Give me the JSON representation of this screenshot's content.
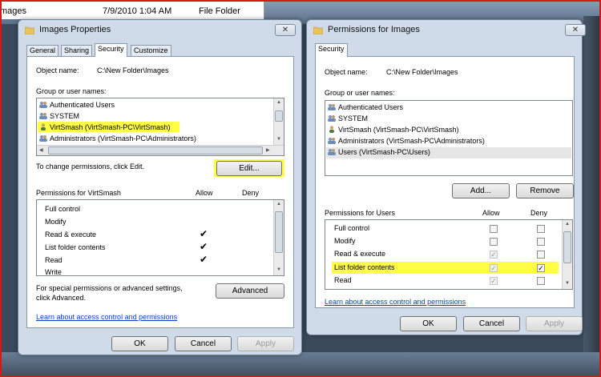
{
  "background": {
    "file_row": {
      "name": "mages",
      "date": "7/9/2010 1:04 AM",
      "type": "File Folder"
    }
  },
  "props": {
    "title": "Images Properties",
    "close_glyph": "✕",
    "tabs": [
      "General",
      "Sharing",
      "Security",
      "Customize"
    ],
    "object_label": "Object name:",
    "object_value": "C:\\New Folder\\Images",
    "group_label": "Group or user names:",
    "users": [
      "Authenticated Users",
      "SYSTEM",
      "VirtSmash (VirtSmash-PC\\VirtSmash)",
      "Administrators (VirtSmash-PC\\Administrators)"
    ],
    "change_text": "To change permissions, click Edit.",
    "edit_label": "Edit...",
    "perm_header": "Permissions for VirtSmash",
    "allow_header": "Allow",
    "deny_header": "Deny",
    "permissions": [
      {
        "name": "Full control",
        "allow": false
      },
      {
        "name": "Modify",
        "allow": false
      },
      {
        "name": "Read & execute",
        "allow": true
      },
      {
        "name": "List folder contents",
        "allow": true
      },
      {
        "name": "Read",
        "allow": true
      },
      {
        "name": "Write",
        "allow": false
      }
    ],
    "tick_glyph": "✔",
    "special_text_1": "For special permissions or advanced settings,",
    "special_text_2": "click Advanced.",
    "advanced_label": "Advanced",
    "learn_link": "Learn about access control and permissions",
    "ok_label": "OK",
    "cancel_label": "Cancel",
    "apply_label": "Apply"
  },
  "perms": {
    "title": "Permissions for Images",
    "close_glyph": "✕",
    "tab": "Security",
    "object_label": "Object name:",
    "object_value": "C:\\New Folder\\Images",
    "group_label": "Group or user names:",
    "users": [
      "Authenticated Users",
      "SYSTEM",
      "VirtSmash (VirtSmash-PC\\VirtSmash)",
      "Administrators (VirtSmash-PC\\Administrators)",
      "Users (VirtSmash-PC\\Users)"
    ],
    "add_label": "Add...",
    "remove_label": "Remove",
    "perm_header": "Permissions for Users",
    "allow_header": "Allow",
    "deny_header": "Deny",
    "permissions": [
      {
        "name": "Full control",
        "allow": false,
        "allow_disabled": false,
        "deny": false
      },
      {
        "name": "Modify",
        "allow": false,
        "allow_disabled": false,
        "deny": false
      },
      {
        "name": "Read & execute",
        "allow": true,
        "allow_disabled": true,
        "deny": false
      },
      {
        "name": "List folder contents",
        "allow": true,
        "allow_disabled": true,
        "deny": true
      },
      {
        "name": "Read",
        "allow": true,
        "allow_disabled": true,
        "deny": false
      }
    ],
    "check_glyph": "✓",
    "learn_link": "Learn about access control and permissions",
    "ok_label": "OK",
    "cancel_label": "Cancel",
    "apply_label": "Apply"
  },
  "colors": {
    "highlight": "#fffe44",
    "link": "#0044cc",
    "frame": "#d81818",
    "window": "#cfdbe9"
  }
}
